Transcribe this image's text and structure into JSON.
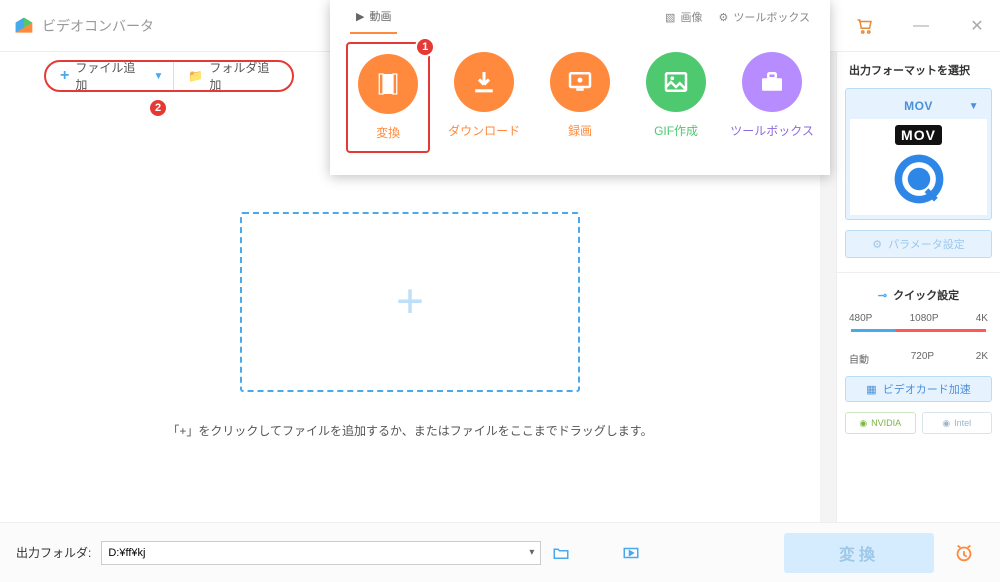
{
  "app": {
    "title": "ビデオコンバータ"
  },
  "annotations": {
    "step1": "1",
    "step2": "2"
  },
  "toolbar": {
    "add_file": "ファイル追加",
    "add_folder": "フォルダ追加"
  },
  "popup": {
    "tabs": {
      "video": "動画",
      "image": "画像",
      "toolbox": "ツールボックス"
    },
    "cards": {
      "convert": "変換",
      "download": "ダウンロード",
      "record": "録画",
      "gif": "GIF作成",
      "toolbox": "ツールボックス"
    }
  },
  "dropzone": {
    "hint": "「+」をクリックしてファイルを追加するか、またはファイルをここまでドラッグします。"
  },
  "sidebar": {
    "title": "出力フォーマットを選択",
    "format": "MOV",
    "format_badge": "MOV",
    "params": "パラメータ設定",
    "quick_title": "クイック設定",
    "res_top": {
      "a": "480P",
      "b": "1080P",
      "c": "4K"
    },
    "res_bot": {
      "a": "自動",
      "b": "720P",
      "c": "2K"
    },
    "gpu": "ビデオカード加速",
    "nvidia": "NVIDIA",
    "intel": "Intel"
  },
  "bottom": {
    "out_label": "出力フォルダ:",
    "out_path": "D:¥ff¥kj",
    "convert": "変換"
  }
}
